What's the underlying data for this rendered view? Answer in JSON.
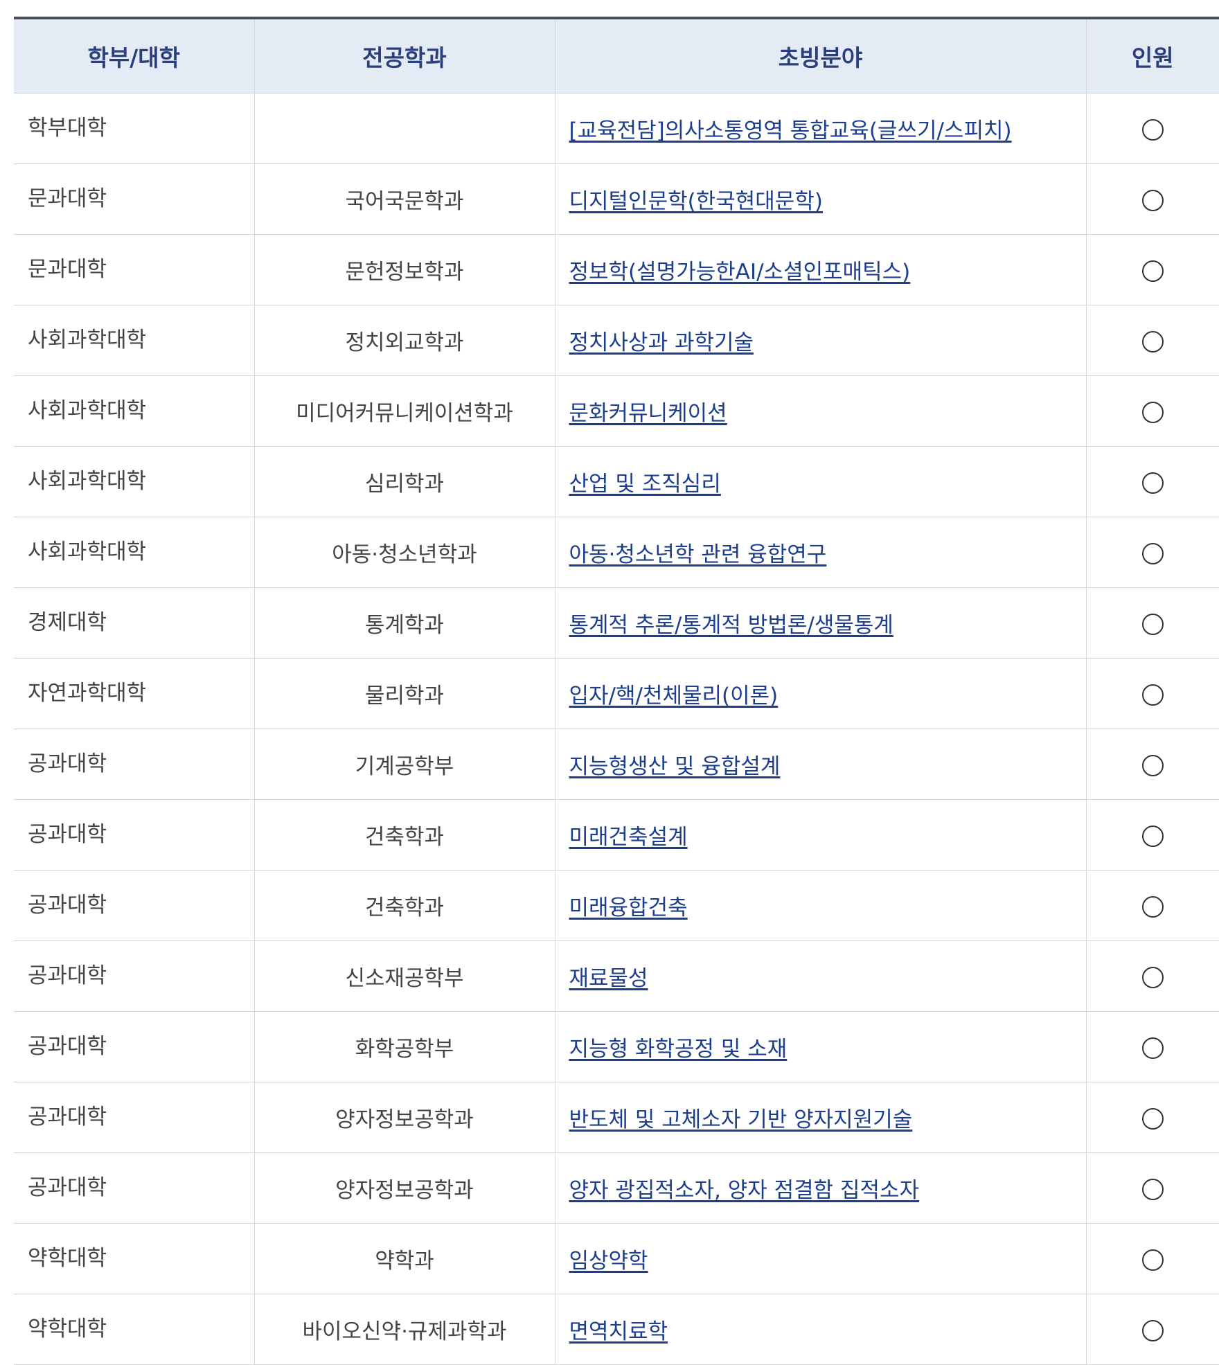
{
  "table": {
    "headers": {
      "college": "학부/대학",
      "department": "전공학과",
      "field": "초빙분야",
      "count": "인원"
    },
    "rows": [
      {
        "college": "학부대학",
        "department": "",
        "field": "[교육전담]의사소통영역 통합교육(글쓰기/스피치)",
        "count": "circle-icon"
      },
      {
        "college": "문과대학",
        "department": "국어국문학과",
        "field": "디지털인문학(한국현대문학)",
        "count": "circle-icon"
      },
      {
        "college": "문과대학",
        "department": "문헌정보학과",
        "field": "정보학(설명가능한AI/소셜인포매틱스)",
        "count": "circle-icon"
      },
      {
        "college": "사회과학대학",
        "department": "정치외교학과",
        "field": "정치사상과 과학기술",
        "count": "circle-icon"
      },
      {
        "college": "사회과학대학",
        "department": "미디어커뮤니케이션학과",
        "field": "문화커뮤니케이션",
        "count": "circle-icon"
      },
      {
        "college": "사회과학대학",
        "department": "심리학과",
        "field": "산업 및 조직심리",
        "count": "circle-icon"
      },
      {
        "college": "사회과학대학",
        "department": "아동·청소년학과",
        "field": "아동·청소년학 관련 융합연구",
        "count": "circle-icon"
      },
      {
        "college": "경제대학",
        "department": "통계학과",
        "field": "통계적 추론/통계적 방법론/생물통계",
        "count": "circle-icon"
      },
      {
        "college": "자연과학대학",
        "department": "물리학과",
        "field": "입자/핵/천체물리(이론)",
        "count": "circle-icon"
      },
      {
        "college": "공과대학",
        "department": "기계공학부",
        "field": "지능형생산 및 융합설계",
        "count": "circle-icon"
      },
      {
        "college": "공과대학",
        "department": "건축학과",
        "field": "미래건축설계",
        "count": "circle-icon"
      },
      {
        "college": "공과대학",
        "department": "건축학과",
        "field": "미래융합건축",
        "count": "circle-icon"
      },
      {
        "college": "공과대학",
        "department": "신소재공학부",
        "field": "재료물성",
        "count": "circle-icon"
      },
      {
        "college": "공과대학",
        "department": "화학공학부",
        "field": "지능형 화학공정 및 소재",
        "count": "circle-icon"
      },
      {
        "college": "공과대학",
        "department": "양자정보공학과",
        "field": "반도체 및 고체소자 기반 양자지원기술",
        "count": "circle-icon"
      },
      {
        "college": "공과대학",
        "department": "양자정보공학과",
        "field": "양자 광집적소자, 양자 점결함 집적소자",
        "count": "circle-icon"
      },
      {
        "college": "약학대학",
        "department": "약학과",
        "field": "임상약학",
        "count": "circle-icon"
      },
      {
        "college": "약학대학",
        "department": "바이오신약·규제과학과",
        "field": "면역치료학",
        "count": "circle-icon"
      }
    ]
  },
  "colors": {
    "header_bg": "#e4ebf5",
    "header_text": "#2a3f7c",
    "link": "#1c3e8c",
    "top_border": "#4a4d55"
  }
}
